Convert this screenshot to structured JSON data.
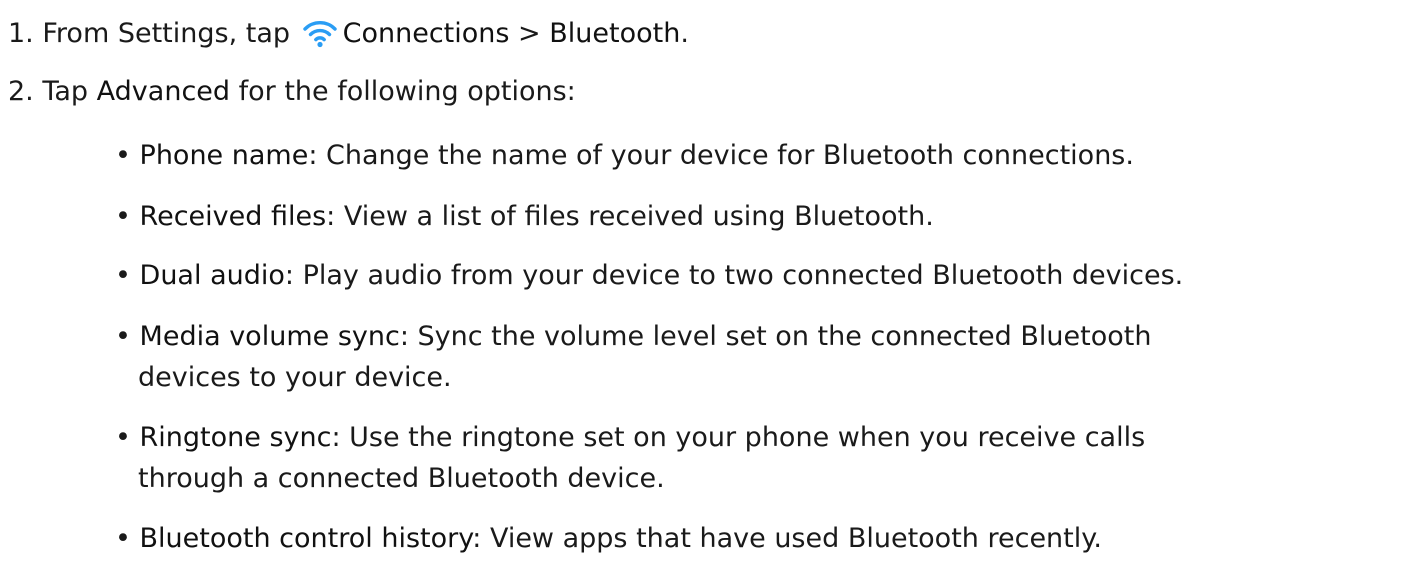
{
  "steps": [
    {
      "number": "1.",
      "pre": "From Settings, tap",
      "icon": "wifi-icon",
      "icon_color": "#2a9df4",
      "term1": "Connections",
      "sep": ">",
      "term2": "Bluetooth",
      "post": "."
    },
    {
      "number": "2.",
      "pre": "Tap",
      "term": "Advanced",
      "post": "for the following options:"
    }
  ],
  "options": [
    {
      "term": "Phone name",
      "desc": ": Change the name of your device for Bluetooth connections."
    },
    {
      "term": "Received files",
      "desc": ": View a list of files received using Bluetooth."
    },
    {
      "term": "Dual audio",
      "desc": ": Play audio from your device to two connected Bluetooth devices."
    },
    {
      "term": "Media volume sync",
      "desc": ": Sync the volume level set on the connected Bluetooth",
      "desc_line2": "devices to your device."
    },
    {
      "term": "Ringtone sync",
      "desc": ": Use the ringtone set on your phone when you receive calls",
      "desc_line2": "through a connected Bluetooth device."
    },
    {
      "term": "Bluetooth control history",
      "desc": ": View apps that have used Bluetooth recently."
    }
  ],
  "bullet_char": "•"
}
